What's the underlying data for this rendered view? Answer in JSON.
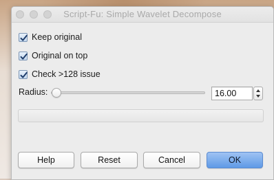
{
  "window": {
    "title": "Script-Fu: Simple Wavelet Decompose"
  },
  "options": [
    {
      "label": "Keep original",
      "checked": true
    },
    {
      "label": "Original on top",
      "checked": true
    },
    {
      "label": "Check >128 issue",
      "checked": true
    }
  ],
  "radius": {
    "label": "Radius:",
    "value": "16.00",
    "slider_fraction": 0.03
  },
  "progress": {
    "text": "",
    "fraction": 0
  },
  "buttons": {
    "help": "Help",
    "reset": "Reset",
    "cancel": "Cancel",
    "ok": "OK"
  },
  "colors": {
    "default_button": "#5f9ae6",
    "checkbox_check": "#1f3d6b"
  },
  "icons": [
    "close-icon",
    "minimize-icon",
    "maximize-icon",
    "checkmark-icon",
    "spin-up-icon",
    "spin-down-icon"
  ]
}
